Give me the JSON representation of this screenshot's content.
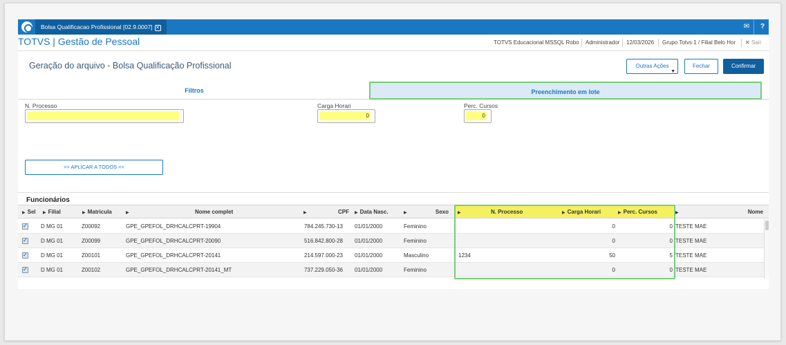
{
  "app": {
    "tab_title": "Bolsa Qualificacao Profissional [02.9.0007]",
    "brand": "TOTVS | Gestão de Pessoal",
    "header_info": {
      "environment": "TOTVS Educacional MSSQL Robo",
      "user": "Administrador",
      "date": "12/03/2026",
      "branch": "Grupo Totvs 1 / Filial Belo Hor",
      "exit_label": "Sair"
    },
    "icons": {
      "logo": "totvs-logo-icon",
      "mail": "mail-icon",
      "help": "help-icon",
      "close": "close-icon"
    }
  },
  "page": {
    "title": "Geração do arquivo - Bolsa Qualificação Profissional",
    "buttons": {
      "other_actions": "Outras Ações",
      "close": "Fechar",
      "confirm": "Confirmar"
    }
  },
  "tabs": [
    {
      "label": "Filtros",
      "active": false
    },
    {
      "label": "Preenchimento em lote",
      "active": true
    }
  ],
  "form": {
    "n_processo": {
      "label": "N. Processo",
      "value": ""
    },
    "carga_horari": {
      "label": "Carga Horari",
      "value": "0"
    },
    "perc_cursos": {
      "label": "Perc. Cursos",
      "value": "0"
    },
    "apply_all": ">> APLICAR A TODOS <<"
  },
  "grid": {
    "title": "Funcionários",
    "columns": [
      "Sel",
      "Filial",
      "Matricula",
      "Nome complet",
      "CPF",
      "Data Nasc.",
      "Sexo",
      "N. Processo",
      "Carga Horari",
      "Perc. Cursos",
      "Nome"
    ],
    "rows": [
      {
        "filial": "D MG 01",
        "matricula": "Z00092",
        "nome": "GPE_GPEFOL_DRHCALCPRT-19904",
        "cpf": "784.245.730-13",
        "nasc": "01/01/2000",
        "sexo": "Feminino",
        "processo": "",
        "carga": "0",
        "perc": "0",
        "mae": "TESTE MAE"
      },
      {
        "filial": "D MG 01",
        "matricula": "Z00099",
        "nome": "GPE_GPEFOL_DRHCALCPRT-20090",
        "cpf": "516.842.800-28",
        "nasc": "01/01/2000",
        "sexo": "Feminino",
        "processo": "",
        "carga": "0",
        "perc": "0",
        "mae": "TESTE MAE"
      },
      {
        "filial": "D MG 01",
        "matricula": "Z00101",
        "nome": "GPE_GPEFOL_DRHCALCPRT-20141",
        "cpf": "214.597.000-23",
        "nasc": "01/01/2000",
        "sexo": "Masculino",
        "processo": "1234",
        "carga": "50",
        "perc": "5",
        "mae": "TESTE MAE"
      },
      {
        "filial": "D MG 01",
        "matricula": "Z00102",
        "nome": "GPE_GPEFOL_DRHCALCPRT-20141_MT",
        "cpf": "737.229.050-36",
        "nasc": "01/01/2000",
        "sexo": "Feminino",
        "processo": "",
        "carga": "0",
        "perc": "0",
        "mae": "TESTE MAE"
      }
    ]
  }
}
